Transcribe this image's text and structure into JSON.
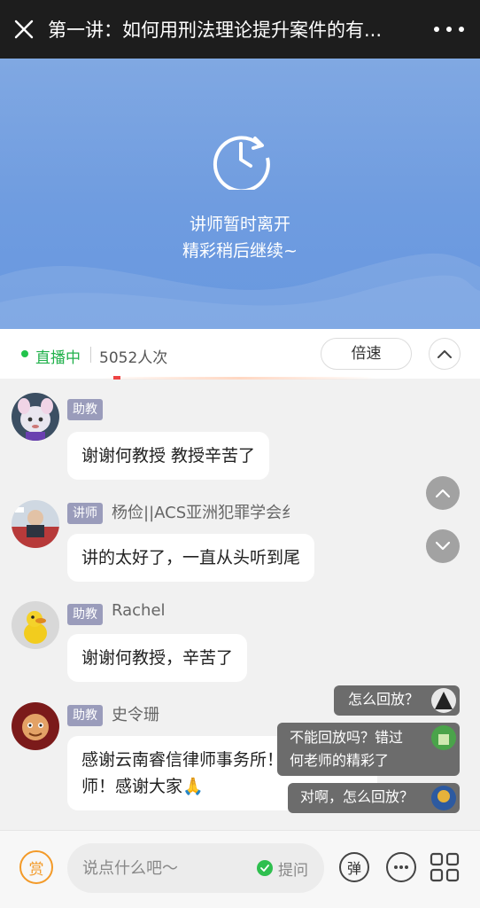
{
  "header": {
    "title": "第一讲：如何用刑法理论提升案件的有..."
  },
  "video": {
    "line1": "讲师暂时离开",
    "line2": "精彩稍后继续~"
  },
  "status": {
    "live_label": "直播中",
    "viewers": "5052人次",
    "speed_label": "倍速"
  },
  "messages": [
    {
      "role": "助教",
      "sender": "",
      "text": "谢谢何教授 教授辛苦了"
    },
    {
      "role": "讲师",
      "sender": "杨俭||ACS亚洲犯罪学会纟",
      "text": "讲的太好了，一直从头听到尾"
    },
    {
      "role": "助教",
      "sender": "Rachel",
      "text": "谢谢何教授，辛苦了"
    },
    {
      "role": "助教",
      "sender": "史令珊",
      "text_line1": "感谢云南睿信律师事务所！感谢何老",
      "text_line2": "师！感谢大家🙏"
    }
  ],
  "danmaku": [
    {
      "text": "怎么回放？"
    },
    {
      "text_line1": "不能回放吗？错过",
      "text_line2": "何老师的精彩了"
    },
    {
      "text": "对啊，怎么回放？"
    }
  ],
  "footer": {
    "reward_label": "赏",
    "input_placeholder": "说点什么吧～",
    "ask_label": "提问",
    "danmaku_label": "弹"
  }
}
